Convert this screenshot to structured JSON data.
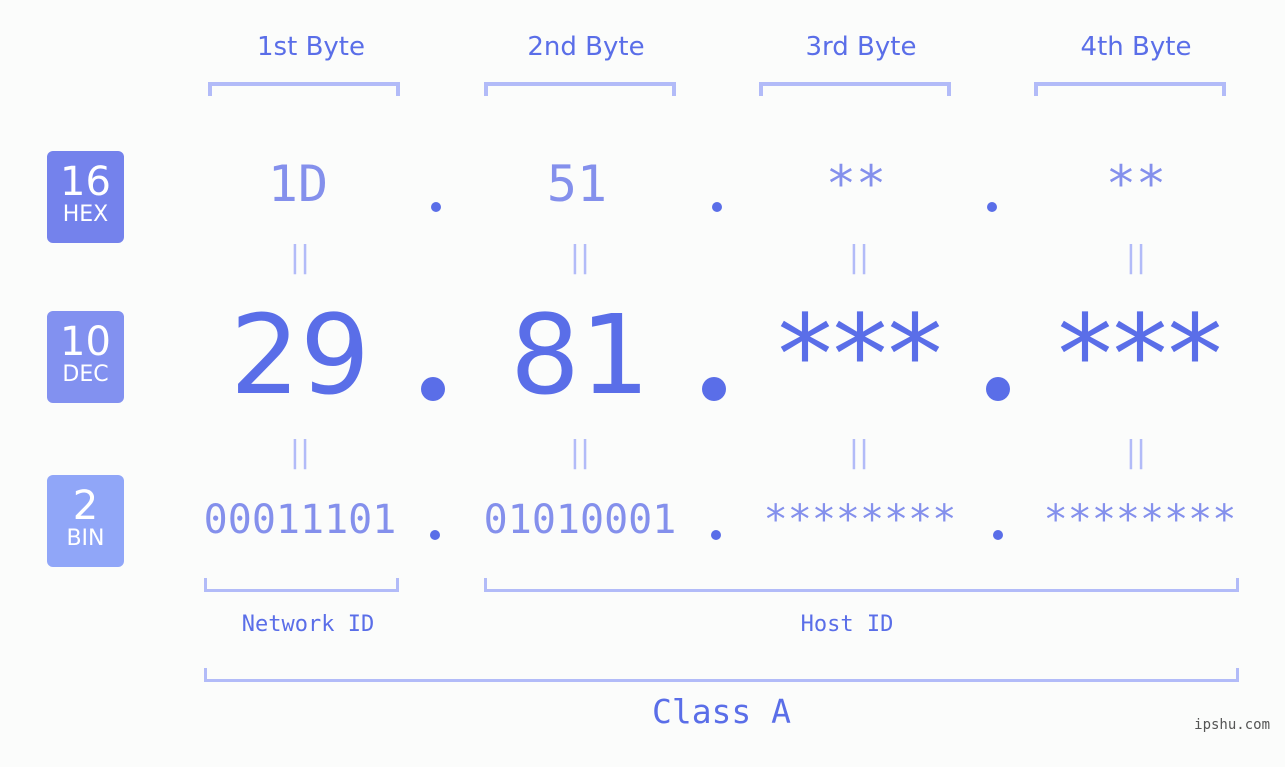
{
  "colors": {
    "accent": "#5a6ee8",
    "value_light": "#8490ec",
    "bracket": "#b2bbf8",
    "hex_badge": "#7482ec",
    "dec_badge": "#8291f0",
    "bin_badge": "#90a6f8",
    "background": "#fbfcfb"
  },
  "bytes": [
    {
      "label": "1st Byte",
      "hex": "1D",
      "dec": "29",
      "bin": "00011101"
    },
    {
      "label": "2nd Byte",
      "hex": "51",
      "dec": "81",
      "bin": "01010001"
    },
    {
      "label": "3rd Byte",
      "hex": "**",
      "dec": "***",
      "bin": "********"
    },
    {
      "label": "4th Byte",
      "hex": "**",
      "dec": "***",
      "bin": "********"
    }
  ],
  "bases": [
    {
      "number": "16",
      "label": "HEX"
    },
    {
      "number": "10",
      "label": "DEC"
    },
    {
      "number": "2",
      "label": "BIN"
    }
  ],
  "equals_symbol": "||",
  "network_id_label": "Network ID",
  "host_id_label": "Host ID",
  "class_label": "Class A",
  "watermark": "ipshu.com"
}
